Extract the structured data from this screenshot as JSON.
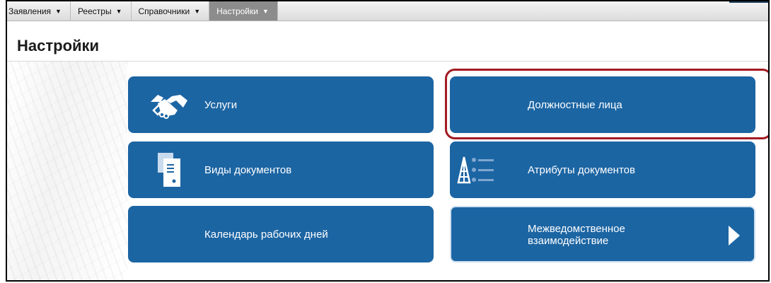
{
  "menubar": {
    "items": [
      {
        "label": "Заявления",
        "caret": "▼"
      },
      {
        "label": "Реестры",
        "caret": "▼"
      },
      {
        "label": "Справочники",
        "caret": "▼"
      },
      {
        "label": "Настройки",
        "caret": "▼"
      }
    ]
  },
  "page": {
    "title": "Настройки"
  },
  "tiles": [
    {
      "label": "Услуги",
      "icon": "handshake-icon"
    },
    {
      "label": "Должностные лица",
      "highlighted": true
    },
    {
      "label": "Виды документов",
      "icon": "documents-icon"
    },
    {
      "label": "Атрибуты документов",
      "icon": "attributes-tower-icon"
    },
    {
      "label": "Календарь рабочих дней"
    },
    {
      "label_line1": "Межведомственное",
      "label_line2": "взаимодействие",
      "icon": "play-arrow-icon"
    }
  ],
  "colors": {
    "tile": "#1c65a3",
    "highlight": "#a31b23",
    "menu_active": "#8c8c8c"
  }
}
